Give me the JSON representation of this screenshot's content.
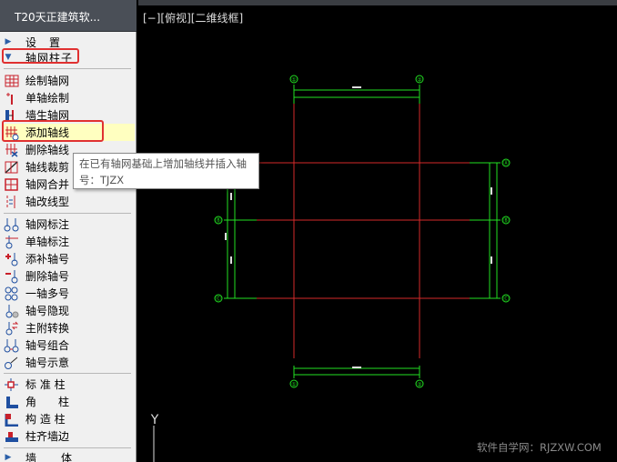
{
  "app": {
    "title": "T20天正建筑软..."
  },
  "palette": {
    "settings_group": {
      "label": "设　置",
      "arrow": "▶"
    },
    "axis_group": {
      "label": "轴网柱子",
      "arrow": "▼"
    },
    "axis_items": [
      {
        "label": "绘制轴网",
        "icon": "grid-icon"
      },
      {
        "label": "单轴绘制",
        "icon": "single-axis-icon"
      },
      {
        "label": "墙生轴网",
        "icon": "wall-to-grid-icon"
      },
      {
        "label": "添加轴线",
        "icon": "add-axis-icon",
        "highlighted": true
      },
      {
        "label": "删除轴线",
        "icon": "delete-axis-icon"
      },
      {
        "label": "轴线裁剪",
        "icon": "trim-axis-icon"
      },
      {
        "label": "轴网合并",
        "icon": "merge-grid-icon"
      },
      {
        "label": "轴改线型",
        "icon": "linetype-icon"
      }
    ],
    "label_items": [
      {
        "label": "轴网标注",
        "icon": "grid-dimension-icon"
      },
      {
        "label": "单轴标注",
        "icon": "single-dimension-icon"
      },
      {
        "label": "添补轴号",
        "icon": "add-number-icon"
      },
      {
        "label": "删除轴号",
        "icon": "delete-number-icon"
      },
      {
        "label": "一轴多号",
        "icon": "multi-number-icon"
      },
      {
        "label": "轴号隐现",
        "icon": "toggle-number-icon"
      },
      {
        "label": "主附转换",
        "icon": "convert-icon"
      },
      {
        "label": "轴号组合",
        "icon": "combine-number-icon"
      },
      {
        "label": "轴号示意",
        "icon": "number-hint-icon"
      }
    ],
    "column_items": [
      {
        "label": "标 准 柱",
        "icon": "standard-column-icon"
      },
      {
        "label": "角　　柱",
        "icon": "corner-column-icon"
      },
      {
        "label": "构 造 柱",
        "icon": "structural-column-icon"
      },
      {
        "label": "柱齐墙边",
        "icon": "align-column-icon"
      }
    ],
    "wall_group": {
      "label": "墙　　体",
      "arrow": "▶"
    }
  },
  "tooltip": {
    "line1": "在已有轴网基础上增加轴线并插入轴",
    "line2": "号：TJZX"
  },
  "viewport": {
    "label": "[−][俯视][二维线框]",
    "ucs_y": "Y"
  },
  "axis_bubbles": {
    "top": [
      "①",
      "②"
    ],
    "bottom": [
      "①",
      "②"
    ],
    "left": [
      "Ⓑ",
      "Ⓒ"
    ],
    "right": [
      "Ⓐ",
      "Ⓑ",
      "Ⓒ"
    ]
  },
  "watermark": "软件自学网：RJZXW.COM",
  "colors": {
    "axis_red": "#d42a2a",
    "dim_green": "#22e022",
    "highlight": "#ffffc0",
    "outline_red": "#e03131"
  }
}
